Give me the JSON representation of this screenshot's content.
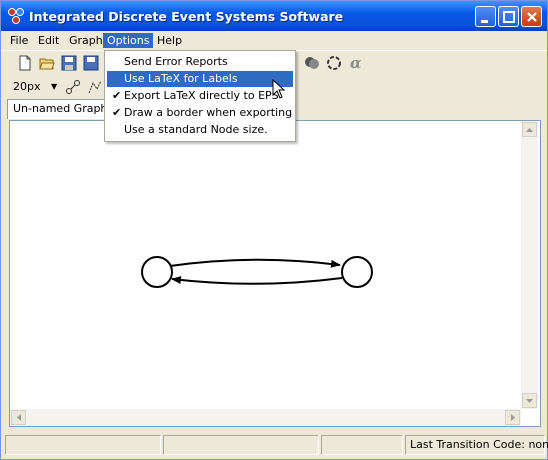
{
  "window": {
    "title": "Integrated Discrete Event Systems Software"
  },
  "menubar": {
    "items": [
      "File",
      "Edit",
      "Graph",
      "Options",
      "Help"
    ]
  },
  "options_menu": {
    "items": [
      {
        "label": "Send Error Reports",
        "checked": false,
        "highlighted": false
      },
      {
        "label": "Use LaTeX for Labels",
        "checked": false,
        "highlighted": true
      },
      {
        "label": "Export LaTeX directly to EPS",
        "checked": true,
        "highlighted": false
      },
      {
        "label": "Draw a border when exporting",
        "checked": true,
        "highlighted": false
      },
      {
        "label": "Use a standard Node size.",
        "checked": false,
        "highlighted": false
      }
    ]
  },
  "toolbar": {
    "zoom_value": "20px"
  },
  "tabs": [
    {
      "label": "Un-named Graph"
    }
  ],
  "statusbar": {
    "last_transition": "Last Transition Code:  none"
  },
  "colors": {
    "menu_highlight": "#316ac5",
    "titlebar": "#0858e8"
  },
  "graph": {
    "nodes": [
      {
        "id": "n1"
      },
      {
        "id": "n2"
      }
    ],
    "edges": [
      {
        "from": "n1",
        "to": "n2"
      },
      {
        "from": "n2",
        "to": "n1"
      }
    ]
  }
}
